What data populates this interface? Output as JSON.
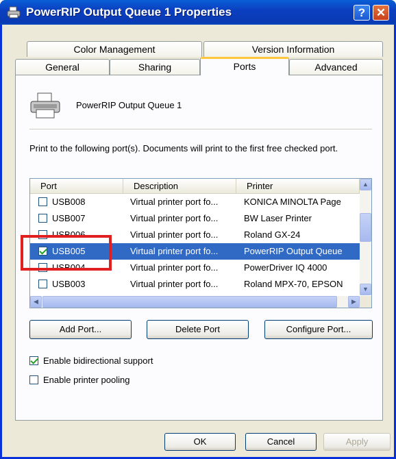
{
  "window": {
    "title": "PowerRIP Output Queue 1 Properties",
    "help_glyph": "?",
    "close_glyph": "✕"
  },
  "tabs": {
    "row1": [
      {
        "label": "Color Management"
      },
      {
        "label": "Version Information"
      }
    ],
    "row2": [
      {
        "label": "General"
      },
      {
        "label": "Sharing"
      },
      {
        "label": "Ports"
      },
      {
        "label": "Advanced"
      }
    ],
    "active": "Ports"
  },
  "panel": {
    "printer_name": "PowerRIP Output Queue 1",
    "instructions": "Print to the following port(s). Documents will print to the first free checked port.",
    "columns": [
      "Port",
      "Description",
      "Printer"
    ],
    "rows": [
      {
        "port": "USB008",
        "description": "Virtual printer port fo...",
        "printer": "KONICA MINOLTA Page",
        "checked": false,
        "selected": false
      },
      {
        "port": "USB007",
        "description": "Virtual printer port fo...",
        "printer": "BW Laser Printer",
        "checked": false,
        "selected": false
      },
      {
        "port": "USB006",
        "description": "Virtual printer port fo...",
        "printer": "Roland GX-24",
        "checked": false,
        "selected": false
      },
      {
        "port": "USB005",
        "description": "Virtual printer port fo...",
        "printer": "PowerRIP Output Queue",
        "checked": true,
        "selected": true
      },
      {
        "port": "USB004",
        "description": "Virtual printer port fo...",
        "printer": "PowerDriver IQ 4000",
        "checked": false,
        "selected": false
      },
      {
        "port": "USB003",
        "description": "Virtual printer port fo...",
        "printer": "Roland MPX-70, EPSON",
        "checked": false,
        "selected": false
      }
    ],
    "buttons": {
      "add_port": "Add Port...",
      "delete_port": "Delete Port",
      "configure_port": "Configure Port..."
    },
    "options": {
      "bidirectional": {
        "label": "Enable bidirectional support",
        "checked": true
      },
      "pooling": {
        "label": "Enable printer pooling",
        "checked": false
      }
    }
  },
  "footer": {
    "ok": "OK",
    "cancel": "Cancel",
    "apply": "Apply"
  },
  "colors": {
    "selection": "#316ac5",
    "title_bar": "#0a3ab3",
    "highlight_box": "#e02020",
    "tab_accent": "#ffc83c"
  }
}
